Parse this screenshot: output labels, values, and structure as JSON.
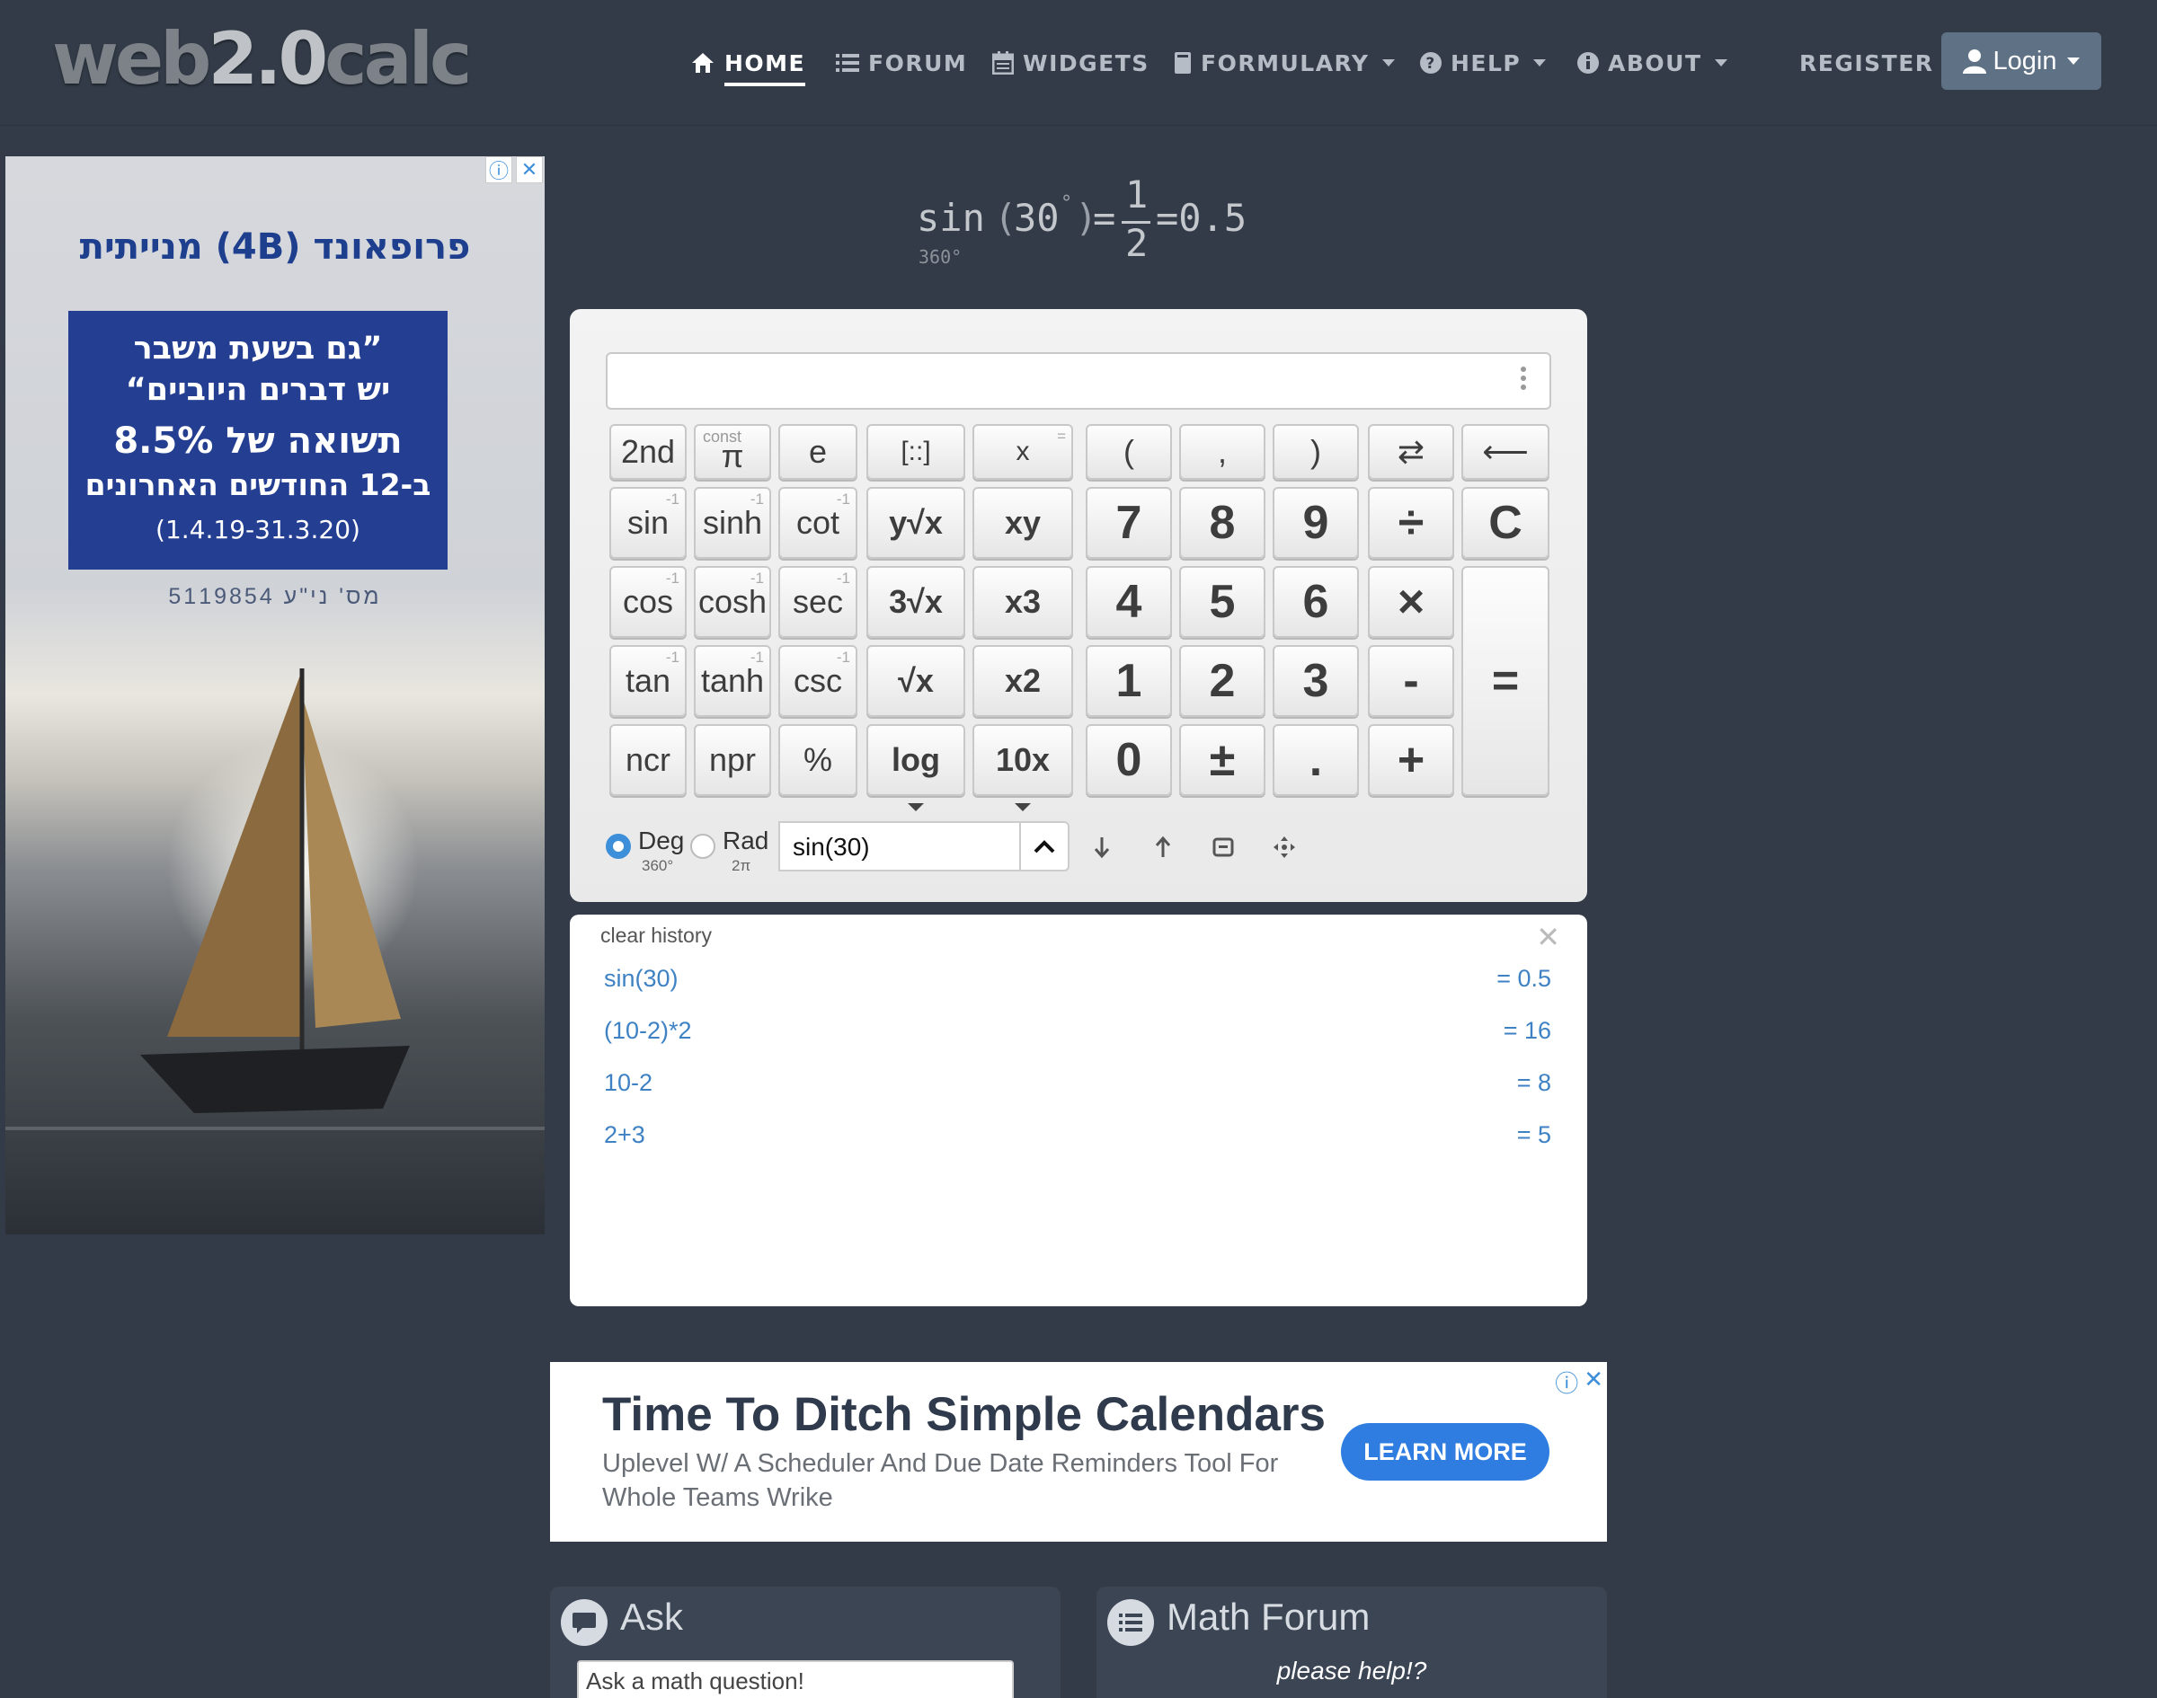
{
  "nav": {
    "logo": {
      "left": "web",
      "mid": "2.0",
      "right": "calc"
    },
    "items": [
      {
        "label": "HOME",
        "icon": "home-icon",
        "active": true
      },
      {
        "label": "FORUM",
        "icon": "list-icon"
      },
      {
        "label": "WIDGETS",
        "icon": "calendar-icon"
      },
      {
        "label": "FORMULARY",
        "icon": "book-icon",
        "dropdown": true
      },
      {
        "label": "HELP",
        "icon": "question-circle-icon",
        "dropdown": true
      },
      {
        "label": "ABOUT",
        "icon": "info-circle-icon",
        "dropdown": true
      }
    ],
    "register": "REGISTER",
    "login": "Login"
  },
  "ad_left": {
    "brand": "פרופאונד (4B) מנייתית",
    "line1": "”גם בשעת משבר",
    "line2": "יש דברים היוביים“",
    "line3": "תשואה של 8.5%",
    "line4": "ב-12 החודשים האחרונים",
    "line5": "(1.4.19-31.3.20)",
    "license": "מס' ני\"ע 5119854"
  },
  "math_title": {
    "func": "sin",
    "arg": "30",
    "deg": "°",
    "sub": "360°",
    "num": "1",
    "den": "2",
    "result": "=0.5"
  },
  "calculator": {
    "keys": {
      "second": "2nd",
      "const": "const",
      "pi": "π",
      "e": "e",
      "matrix": "[::]",
      "x": "x",
      "x_sup": "=",
      "lparen": "(",
      "comma": ",",
      "rparen": ")",
      "swap": "⇄",
      "back": "⟵",
      "sin": "sin",
      "sinh": "sinh",
      "cot": "cot",
      "yroot": "y√x",
      "xy": "xy",
      "cos": "cos",
      "cosh": "cosh",
      "sec": "sec",
      "root3": "3√x",
      "x3": "x3",
      "tan": "tan",
      "tanh": "tanh",
      "csc": "csc",
      "sqrt": "√x",
      "x2": "x2",
      "ncr": "ncr",
      "npr": "npr",
      "percent": "%",
      "log": "log",
      "ten": "10x",
      "inv": "-1",
      "n7": "7",
      "n8": "8",
      "n9": "9",
      "div": "÷",
      "clear": "C",
      "n4": "4",
      "n5": "5",
      "n6": "6",
      "mul": "×",
      "n1": "1",
      "n2": "2",
      "n3": "3",
      "minus": "-",
      "equals": "=",
      "n0": "0",
      "pm": "±",
      "dot": ".",
      "plus": "+"
    },
    "mode": {
      "deg": "Deg",
      "deg_sub": "360°",
      "rad": "Rad",
      "rad_sub": "2π",
      "selected": "Deg"
    },
    "expression": "sin(30)"
  },
  "history": {
    "header": "clear history",
    "rows": [
      {
        "expr": "sin(30)",
        "result": "= 0.5"
      },
      {
        "expr": "(10-2)*2",
        "result": "= 16"
      },
      {
        "expr": "10-2",
        "result": "= 8"
      },
      {
        "expr": "2+3",
        "result": "= 5"
      }
    ]
  },
  "ad_bottom": {
    "title": "Time To Ditch Simple Calendars",
    "desc": "Uplevel W/ A Scheduler And Due Date Reminders Tool For Whole Teams Wrike",
    "cta": "LEARN MORE"
  },
  "panels": {
    "ask": {
      "title": "Ask",
      "placeholder": "Ask a math question!"
    },
    "forum": {
      "title": "Math Forum",
      "tagline": "please help!?"
    }
  },
  "colors": {
    "bg": "#323b47",
    "accent": "#3d8fd9",
    "history_link": "#3f82c4",
    "login_bg": "#5f7184",
    "cta": "#2f7de0"
  }
}
